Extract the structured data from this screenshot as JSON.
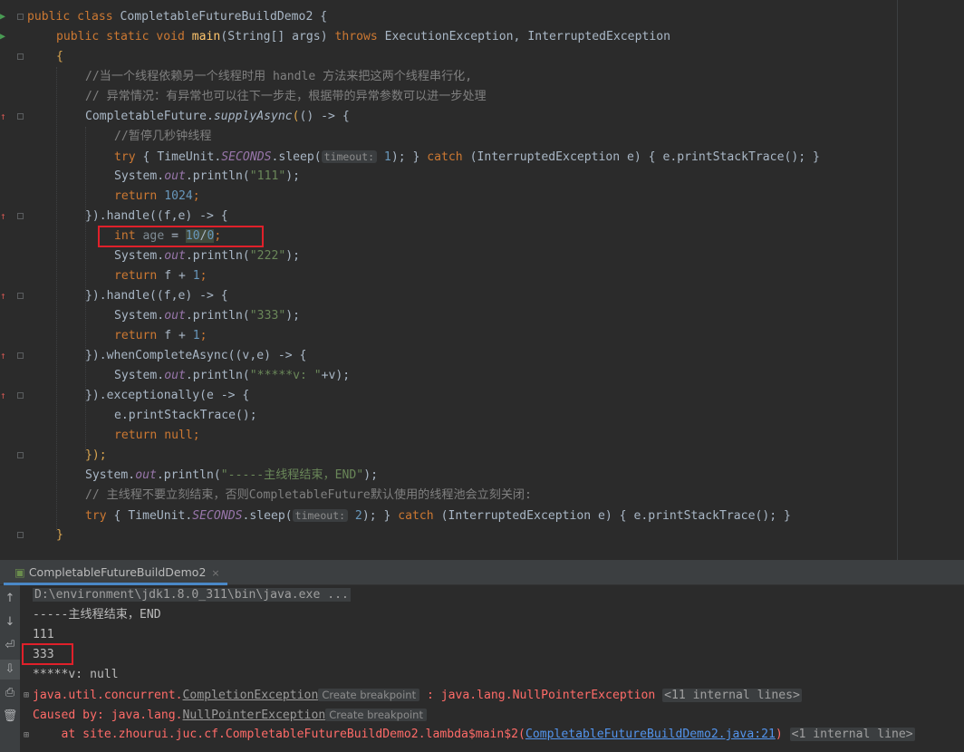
{
  "editor": {
    "c1": "public class ",
    "c2": "CompletableFutureBuildDemo2 ",
    "c3": "{",
    "m1": "public static void ",
    "m2": "main",
    "m3": "(String[] args) ",
    "m4": "throws ",
    "m5": "ExecutionException, InterruptedException",
    "brace_open": "{",
    "cm1": "//当一个线程依赖另一个线程时用 handle 方法来把这两个线程串行化,",
    "cm2": "// 异常情况：有异常也可以往下一步走，根据带的异常参数可以进一步处理",
    "s1a": "CompletableFuture.",
    "s1b": "supplyAsync",
    "s1c": "(",
    "s1d": "() -> {",
    "cm3": "//暂停几秒钟线程",
    "t_try": "try ",
    "t_ob": "{ ",
    "t_tu": "TimeUnit.",
    "t_sec": "SECONDS",
    "t_sl": ".sleep(",
    "t_hint": "timeout:",
    "t_n1": " 1",
    "t_cl": "); ",
    "t_cb": "} ",
    "t_catch": "catch ",
    "t_ex": "(InterruptedException e) ",
    "t_ob2": "{ ",
    "t_pst": "e.printStackTrace(); ",
    "t_cb2": "}",
    "p_sys": "System.",
    "p_out": "out",
    "p_pl": ".println(",
    "p1_str": "\"111\"",
    "p_end": ");",
    "r1_kw": "return ",
    "r1_n": "1024",
    "r1_end": ";",
    "h1a": "}).handle(",
    "h1b": "(f,e) -> {",
    "a_kw": "int ",
    "a_var": "age",
    "a_eq": " = ",
    "a_n1": "10",
    "a_div": "/",
    "a_n2": "0",
    "a_end": ";",
    "p2_str": "\"222\"",
    "r2_kw": "return ",
    "r2_a": "f + ",
    "r2_n": "1",
    "r2_end": ";",
    "p3_str": "\"333\"",
    "w_a": "}).whenCompleteAsync(",
    "w_b": "(v,e) -> {",
    "p4_str": "\"*****v: \"",
    "p4_rest": "+v);",
    "x_a": "}).exceptionally(",
    "x_b": "e -> {",
    "x_pst": "e.printStackTrace();",
    "rn_kw": "return ",
    "rn_null": "null",
    "rn_end": ";",
    "close": "});",
    "p5_str": "\"-----主线程结束，END\"",
    "cm4": "// 主线程不要立刻结束，否则CompletableFuture默认使用的线程池会立刻关闭:",
    "t2_n": " 2",
    "brace_close": "}"
  },
  "run_panel": {
    "tab_title": "CompletableFutureBuildDemo2",
    "tab_close": "×",
    "toolbar": {
      "up": "↑",
      "down": "↓",
      "wrap": "⏎",
      "scroll": "⇩",
      "print": "⎙",
      "trash": "🗑"
    }
  },
  "console": {
    "cmd": "D:\\environment\\jdk1.8.0_311\\bin\\java.exe ...",
    "out1": "-----主线程结束，END",
    "out2": "111",
    "out3": "333",
    "out4": "*****v: null",
    "e1a": "java.util.concurrent.",
    "e1b": "CompletionException",
    "e1bp": "Create breakpoint",
    "e1c": " : java.lang.NullPointerException ",
    "e1d": "<11 internal lines>",
    "e2a": "Caused by: java.lang.",
    "e2b": "NullPointerException",
    "e2bp": "Create breakpoint",
    "e3a": "    at site.zhourui.juc.cf.CompletableFutureBuildDemo2.lambda$main$2(",
    "e3b": "CompletableFutureBuildDemo2.java:21",
    "e3c": ") ",
    "e3d": "<1 internal line>",
    "expand": "⊞"
  },
  "colors": {
    "accent": "#4a88c7",
    "highlight_box": "#e0202a",
    "error": "#ff6b68",
    "link": "#5394ec"
  }
}
